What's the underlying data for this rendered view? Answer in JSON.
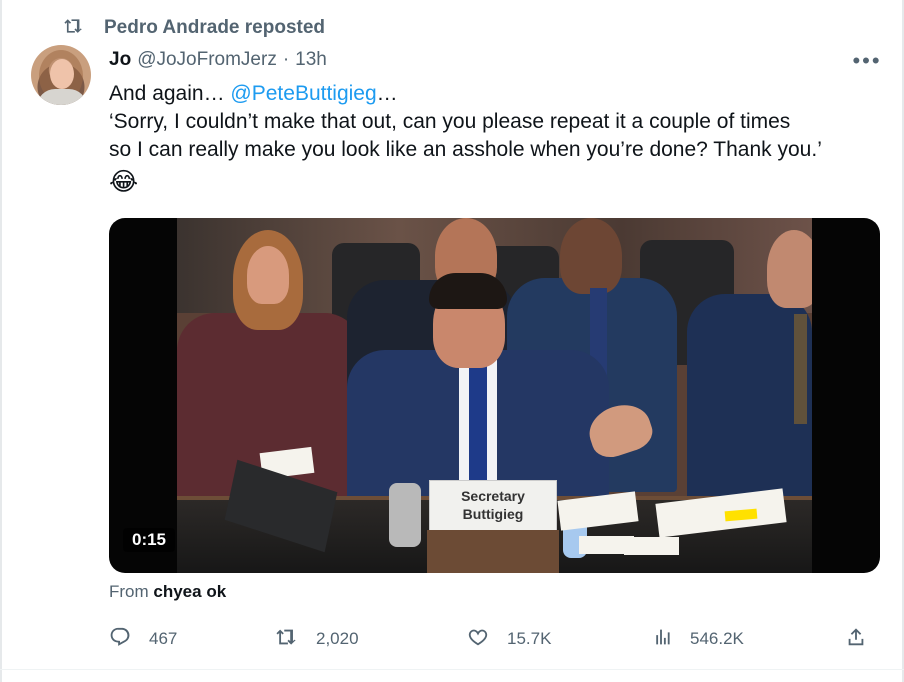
{
  "repost": {
    "text": "Pedro Andrade reposted"
  },
  "tweet": {
    "name": "Jo",
    "handle": "@JoJoFromJerz",
    "dot": "·",
    "time": "13h",
    "line1_prefix": "And again… ",
    "mention": "@PeteButtigieg",
    "line1_suffix": "…",
    "line2": "‘Sorry, I couldn’t make that out, can you please repeat it a couple of times",
    "line3": "so I can really make you look like an asshole when you’re done? Thank you.’",
    "emoji": "😂"
  },
  "video": {
    "placard_line1": "Secretary",
    "placard_line2": "Buttigieg",
    "duration": "0:15"
  },
  "from": {
    "prefix": "From ",
    "source": "chyea ok"
  },
  "metrics": {
    "replies": "467",
    "reposts": "2,020",
    "likes": "15.7K",
    "views": "546.2K"
  },
  "icons": {
    "repost": "repost-icon",
    "more": "more-icon",
    "reply": "reply-icon",
    "like": "heart-icon",
    "views": "analytics-icon",
    "share": "share-icon"
  },
  "colors": {
    "accent": "#1d9bf0",
    "muted_text": "#536471",
    "primary_text": "#0f1419"
  }
}
